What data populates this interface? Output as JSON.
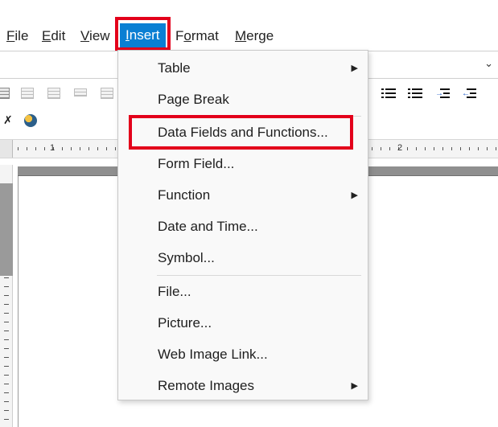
{
  "menubar": {
    "items": [
      {
        "label": "File",
        "mnemonic": "F"
      },
      {
        "label": "Edit",
        "mnemonic": "E"
      },
      {
        "label": "View",
        "mnemonic": "V"
      },
      {
        "label": "Insert",
        "mnemonic": "I"
      },
      {
        "label": "Format",
        "mnemonic": "o"
      },
      {
        "label": "Merge",
        "mnemonic": "M"
      }
    ]
  },
  "ruler": {
    "marks": [
      "1",
      "2"
    ]
  },
  "insert_menu": {
    "items": [
      {
        "label": "Table",
        "submenu": true
      },
      {
        "label": "Page Break",
        "submenu": false
      },
      {
        "label": "Data Fields and Functions...",
        "submenu": false
      },
      {
        "label": "Form Field...",
        "submenu": false
      },
      {
        "label": "Function",
        "submenu": true
      },
      {
        "label": "Date and Time...",
        "submenu": false
      },
      {
        "label": "Symbol...",
        "submenu": false
      },
      {
        "label": "File...",
        "submenu": false
      },
      {
        "label": "Picture...",
        "submenu": false
      },
      {
        "label": "Web Image Link...",
        "submenu": false
      },
      {
        "label": "Remote Images",
        "submenu": true
      }
    ]
  },
  "colors": {
    "active_menu": "#0a7fd3",
    "highlight_box": "#e3001b"
  },
  "icons": {
    "submenu_arrow": "▶",
    "collapse": "⌄"
  }
}
